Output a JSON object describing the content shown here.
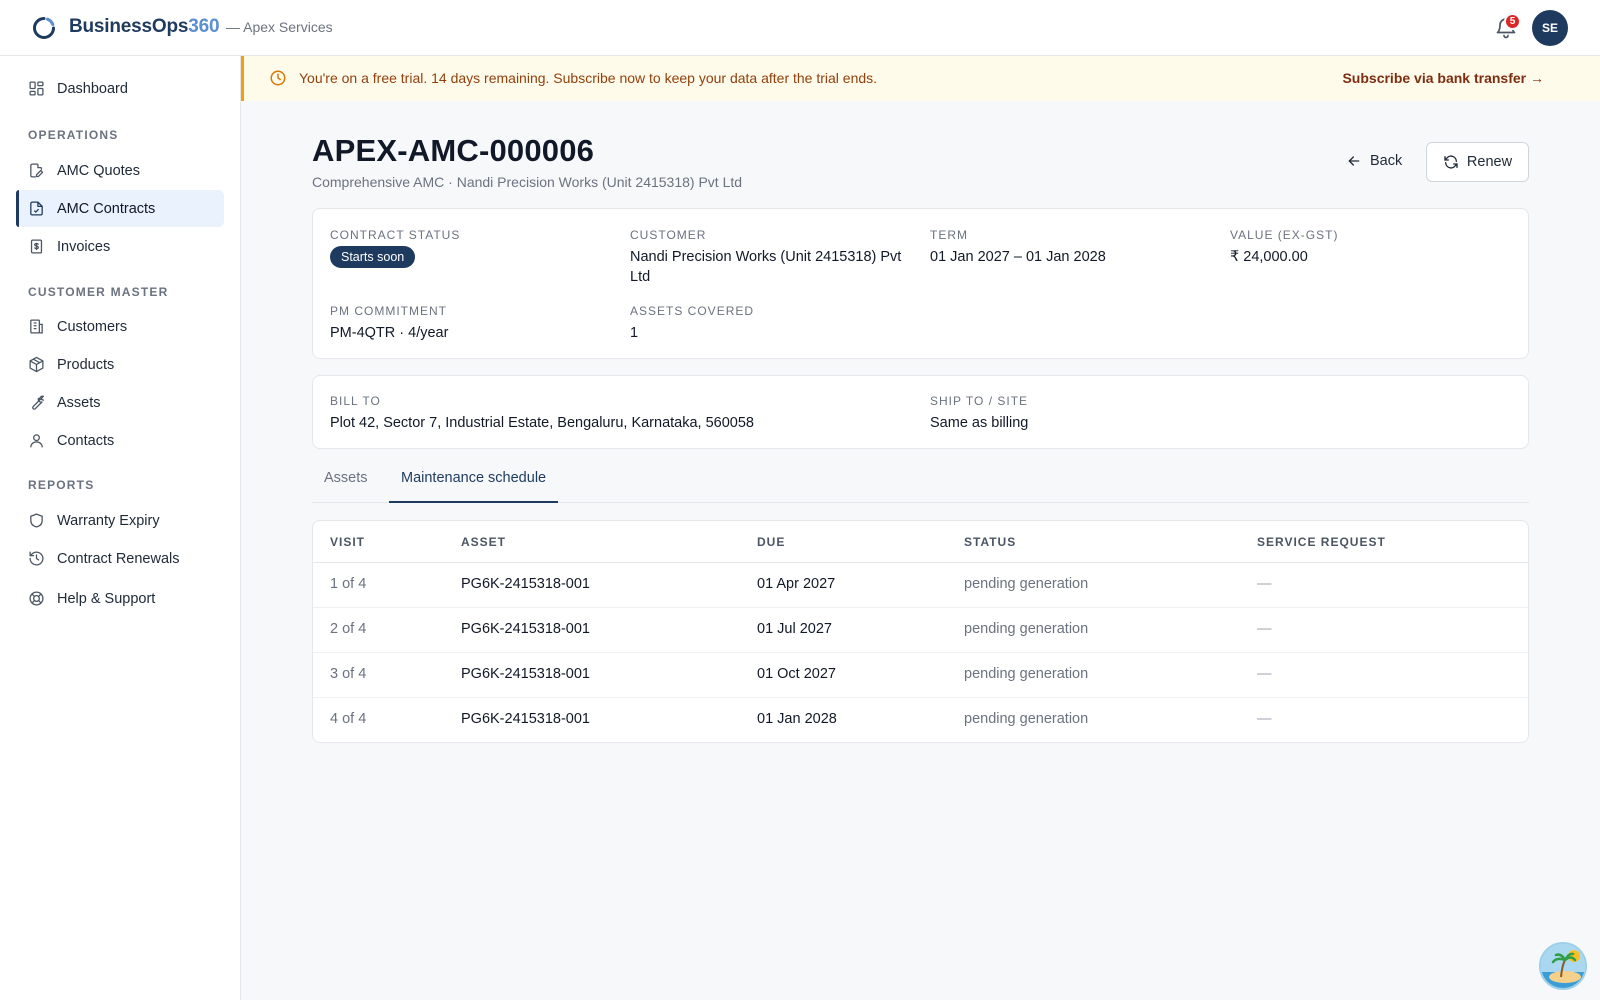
{
  "topbar": {
    "brand_main": "BusinessOps",
    "brand_accent": "360",
    "org": "— Apex Services",
    "notification_count": "5",
    "avatar_initials": "SE"
  },
  "sidebar": {
    "dashboard": "Dashboard",
    "sections": {
      "operations": "OPERATIONS",
      "customer_master": "CUSTOMER MASTER",
      "reports": "REPORTS"
    },
    "items": {
      "amc_quotes": "AMC Quotes",
      "amc_contracts": "AMC Contracts",
      "invoices": "Invoices",
      "customers": "Customers",
      "products": "Products",
      "assets": "Assets",
      "contacts": "Contacts",
      "warranty_expiry": "Warranty Expiry",
      "contract_renewals": "Contract Renewals",
      "help_support": "Help & Support"
    }
  },
  "banner": {
    "text": "You're on a free trial. 14 days remaining. Subscribe now to keep your data after the trial ends.",
    "link": "Subscribe via bank transfer →"
  },
  "header": {
    "title": "APEX-AMC-000006",
    "subtitle": "Comprehensive AMC · Nandi Precision Works (Unit 2415318) Pvt Ltd",
    "back": "Back",
    "renew": "Renew"
  },
  "summary": {
    "contract_status_label": "CONTRACT STATUS",
    "contract_status": "Starts soon",
    "customer_label": "CUSTOMER",
    "customer": "Nandi Precision Works (Unit 2415318) Pvt Ltd",
    "term_label": "TERM",
    "term": "01 Jan 2027 – 01 Jan 2028",
    "value_label": "VALUE (EX-GST)",
    "value": "₹ 24,000.00",
    "pm_label": "PM COMMITMENT",
    "pm": "PM-4QTR · 4/year",
    "assets_label": "ASSETS COVERED",
    "assets": "1"
  },
  "address": {
    "bill_to_label": "BILL TO",
    "bill_to": "Plot 42, Sector 7, Industrial Estate, Bengaluru, Karnataka, 560058",
    "ship_to_label": "SHIP TO / SITE",
    "ship_to": "Same as billing"
  },
  "tabs": {
    "assets": "Assets",
    "maintenance": "Maintenance schedule"
  },
  "schedule": {
    "headers": {
      "visit": "VISIT",
      "asset": "ASSET",
      "due": "DUE",
      "status": "STATUS",
      "service_request": "SERVICE REQUEST"
    },
    "rows": [
      {
        "visit": "1 of 4",
        "asset": "PG6K-2415318-001",
        "due": "01 Apr 2027",
        "status": "pending generation",
        "service_request": "—"
      },
      {
        "visit": "2 of 4",
        "asset": "PG6K-2415318-001",
        "due": "01 Jul 2027",
        "status": "pending generation",
        "service_request": "—"
      },
      {
        "visit": "3 of 4",
        "asset": "PG6K-2415318-001",
        "due": "01 Oct 2027",
        "status": "pending generation",
        "service_request": "—"
      },
      {
        "visit": "4 of 4",
        "asset": "PG6K-2415318-001",
        "due": "01 Jan 2028",
        "status": "pending generation",
        "service_request": "—"
      }
    ]
  },
  "icons": {
    "logo": "loader-ring-icon",
    "bell": "bell-icon",
    "banner": "clock-icon",
    "back": "arrow-left-icon",
    "renew": "refresh-icon"
  },
  "colors": {
    "brand": "#1e3a5f",
    "accent": "#5b8fcf",
    "banner_bg": "#fefbea",
    "banner_border": "#f59e0b",
    "badge": "#dc2626",
    "active_nav_bg": "#eaf2fd"
  }
}
